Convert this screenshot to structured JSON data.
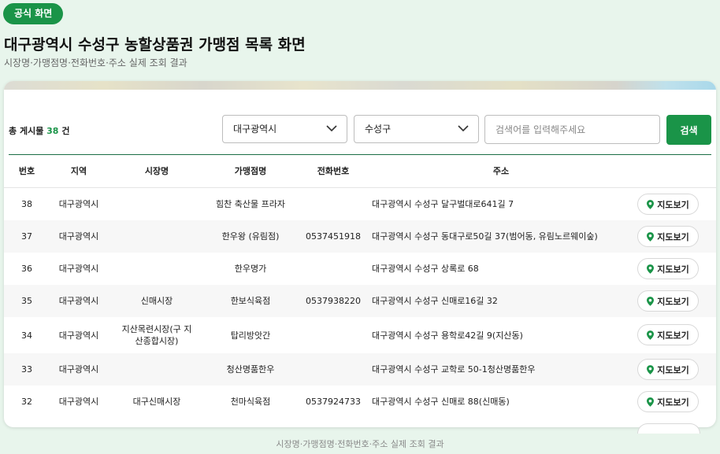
{
  "header": {
    "badge": "공식 화면",
    "title": "대구광역시 수성구 농할상품권 가맹점 목록 화면",
    "subtitle": "시장명·가맹점명·전화번호·주소 실제 조회 결과"
  },
  "filters": {
    "total_prefix": "총 게시물",
    "total_count": "38",
    "total_suffix": "건",
    "city_select": "대구광역시",
    "district_select": "수성구",
    "search_placeholder": "검색어를 입력해주세요",
    "search_button": "검색"
  },
  "table": {
    "columns": [
      "번호",
      "지역",
      "시장명",
      "가맹점명",
      "전화번호",
      "주소"
    ],
    "map_button_label": "지도보기",
    "rows": [
      {
        "no": "38",
        "region": "대구광역시",
        "market": "",
        "store": "힘찬 축산물 프라자",
        "phone": "",
        "address": "대구광역시 수성구 달구벌대로641길 7"
      },
      {
        "no": "37",
        "region": "대구광역시",
        "market": "",
        "store": "한우왕 (유림점)",
        "phone": "0537451918",
        "address": "대구광역시 수성구 동대구로50길 37(범어동, 유림노르웨이숲)"
      },
      {
        "no": "36",
        "region": "대구광역시",
        "market": "",
        "store": "한우명가",
        "phone": "",
        "address": "대구광역시 수성구 상록로 68"
      },
      {
        "no": "35",
        "region": "대구광역시",
        "market": "신매시장",
        "store": "한보식육점",
        "phone": "0537938220",
        "address": "대구광역시 수성구 신매로16길 32"
      },
      {
        "no": "34",
        "region": "대구광역시",
        "market": "지산목련시장(구 지산종합시장)",
        "store": "탑리방앗간",
        "phone": "",
        "address": "대구광역시 수성구 용학로42길 9(지산동)"
      },
      {
        "no": "33",
        "region": "대구광역시",
        "market": "",
        "store": "청산명품한우",
        "phone": "",
        "address": "대구광역시 수성구 교학로 50-1청산명품한우"
      },
      {
        "no": "32",
        "region": "대구광역시",
        "market": "대구신매시장",
        "store": "천마식육점",
        "phone": "0537924733",
        "address": "대구광역시 수성구 신매로 88(신매동)"
      }
    ]
  },
  "footer": {
    "note": "시장명·가맹점명·전화번호·주소 실제 조회 결과"
  },
  "icons": {
    "chevron": "chevron-down-icon",
    "pin": "map-pin-icon"
  },
  "colors": {
    "brand": "#1a9448",
    "background": "#e8f5ec"
  }
}
